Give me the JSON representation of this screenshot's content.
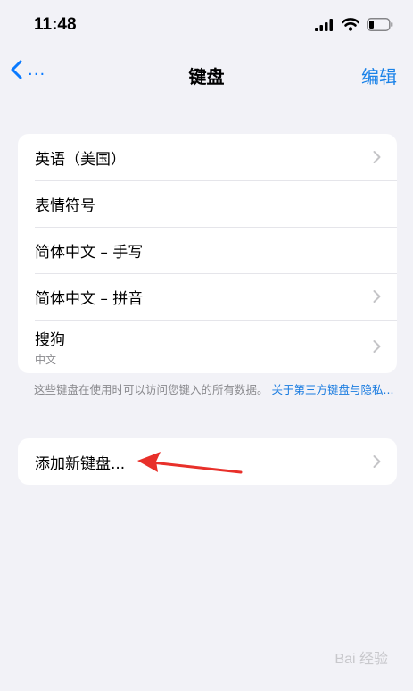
{
  "status_bar": {
    "time": "11:48"
  },
  "nav": {
    "back_label": "...",
    "title": "键盘",
    "edit_label": "编辑"
  },
  "keyboards": [
    {
      "label": "英语（美国）",
      "sub": "",
      "chevron": true
    },
    {
      "label": "表情符号",
      "sub": "",
      "chevron": false
    },
    {
      "label": "简体中文 – 手写",
      "sub": "",
      "chevron": false
    },
    {
      "label": "简体中文 – 拼音",
      "sub": "",
      "chevron": true
    },
    {
      "label": "搜狗",
      "sub": "中文",
      "chevron": true
    }
  ],
  "footnote": {
    "text": "这些键盘在使用时可以访问您键入的所有数据。",
    "link": "关于第三方键盘与隐私..."
  },
  "add_keyboard": {
    "label": "添加新键盘..."
  },
  "watermark": "Bai 经验",
  "colors": {
    "accent": "#0a7aff",
    "background": "#f2f2f7",
    "arrow": "#e8302a"
  }
}
